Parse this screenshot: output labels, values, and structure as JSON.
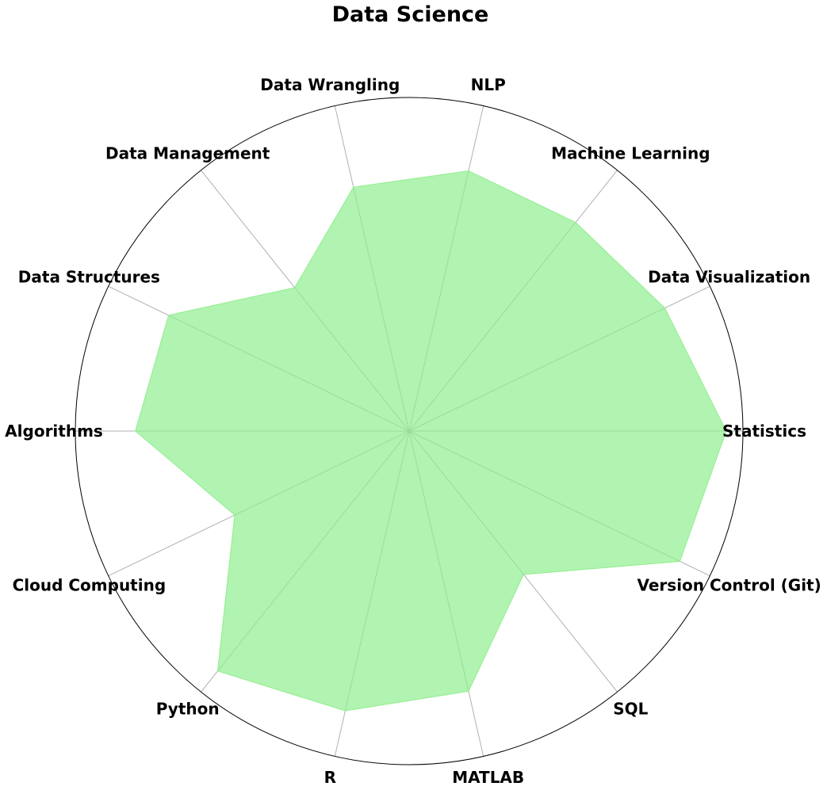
{
  "chart_data": {
    "type": "radar",
    "title": "Data Science",
    "categories": [
      "Statistics",
      "Data Visualization",
      "Machine Learning",
      "NLP",
      "Data Wrangling",
      "Data Management",
      "Data Structures",
      "Algorithms",
      "Cloud Computing",
      "Python",
      "R",
      "MATLAB",
      "SQL",
      "Version Control (Git)"
    ],
    "series": [
      {
        "values": [
          95,
          85,
          80,
          80,
          75,
          55,
          80,
          82,
          58,
          92,
          86,
          80,
          55,
          90
        ]
      }
    ],
    "rlim": [
      0,
      100
    ],
    "grid": true,
    "fill_color": "#90ee90",
    "fill_opacity": 0.7
  }
}
